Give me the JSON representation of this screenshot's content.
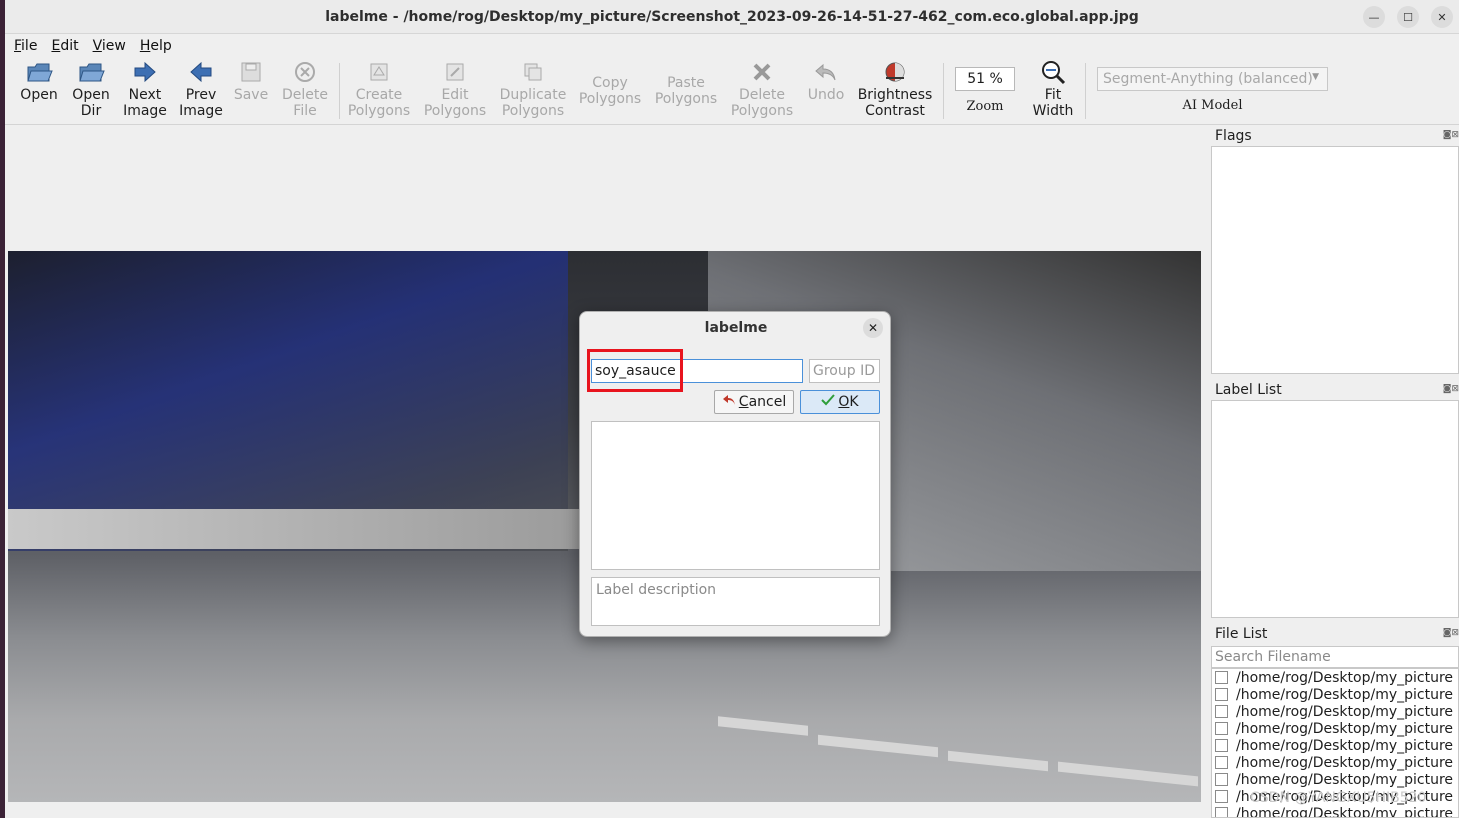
{
  "window": {
    "title": "labelme - /home/rog/Desktop/my_picture/Screenshot_2023-09-26-14-51-27-462_com.eco.global.app.jpg"
  },
  "menu": [
    "File",
    "Edit",
    "View",
    "Help"
  ],
  "toolbar": {
    "open": "Open",
    "open_dir": "Open\nDir",
    "next_image": "Next\nImage",
    "prev_image": "Prev\nImage",
    "save": "Save",
    "delete_file": "Delete\nFile",
    "create_polygons": "Create\nPolygons",
    "edit_polygons": "Edit\nPolygons",
    "duplicate_polygons": "Duplicate\nPolygons",
    "copy_polygons": "Copy\nPolygons",
    "paste_polygons": "Paste\nPolygons",
    "delete_polygons": "Delete\nPolygons",
    "undo": "Undo",
    "brightness_contrast": "Brightness\nContrast",
    "zoom_value": "51 %",
    "zoom_label": "Zoom",
    "fit_width": "Fit\nWidth",
    "ai_model_value": "Segment-Anything (balanced)",
    "ai_model_label": "AI Model"
  },
  "dock": {
    "flags_title": "Flags",
    "label_list_title": "Label List",
    "file_list_title": "File List",
    "search_placeholder": "Search Filename",
    "files": [
      "/home/rog/Desktop/my_picture",
      "/home/rog/Desktop/my_picture",
      "/home/rog/Desktop/my_picture",
      "/home/rog/Desktop/my_picture",
      "/home/rog/Desktop/my_picture",
      "/home/rog/Desktop/my_picture",
      "/home/rog/Desktop/my_picture",
      "/home/rog/Desktop/my_picture",
      "/home/rog/Desktop/my_picture"
    ]
  },
  "dialog": {
    "title": "labelme",
    "label_value": "soy_asauce",
    "group_id_placeholder": "Group ID",
    "cancel": "Cancel",
    "ok": "OK",
    "description_placeholder": "Label description"
  },
  "watermark": "CSDN @YANGXU5HIB520",
  "colors": {
    "highlight": "#e8141e",
    "accent": "#4a90d9",
    "disabled_text": "#a8a8a8"
  }
}
